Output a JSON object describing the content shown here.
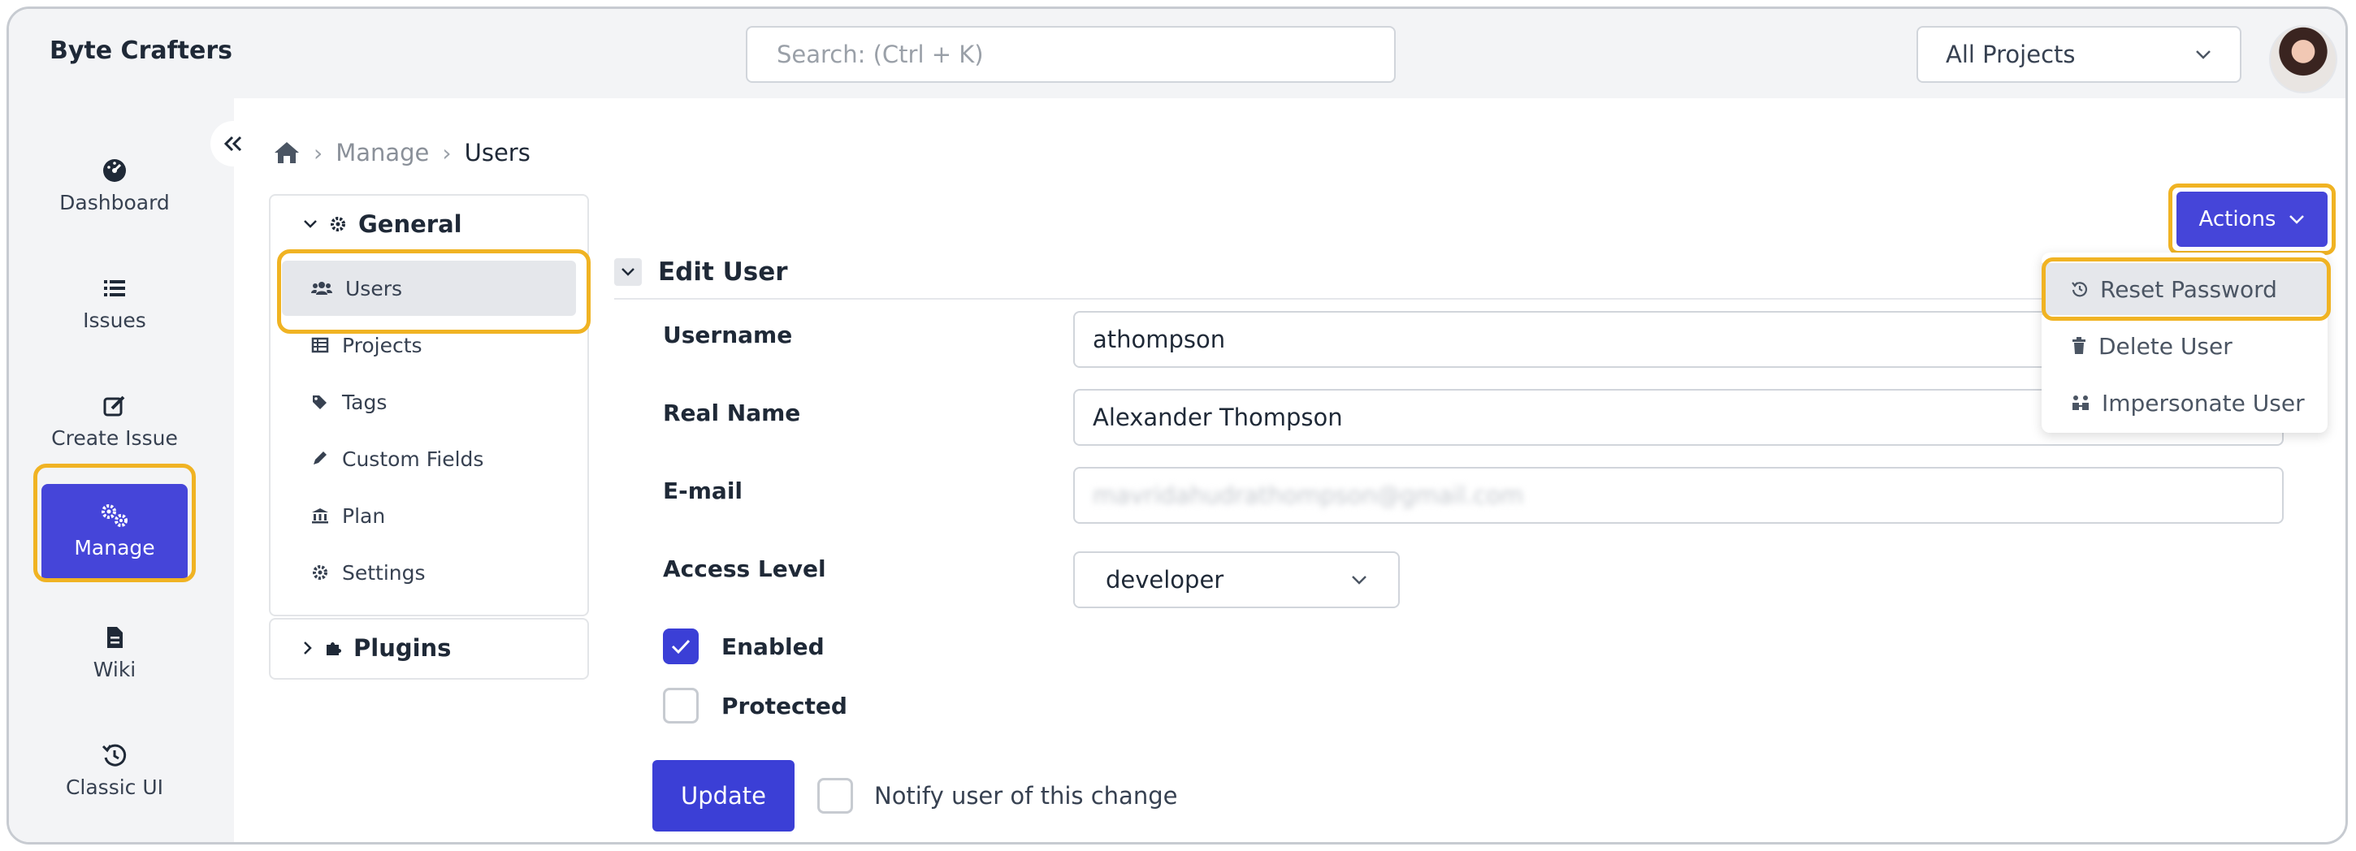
{
  "app": {
    "brand": "Byte Crafters"
  },
  "header": {
    "search_placeholder": "Search: (Ctrl + K)",
    "project_select": "All Projects"
  },
  "leftnav": {
    "items": [
      {
        "label": "Dashboard",
        "icon": "dashboard-icon"
      },
      {
        "label": "Issues",
        "icon": "list-icon"
      },
      {
        "label": "Create Issue",
        "icon": "edit-icon"
      },
      {
        "label": "Manage",
        "icon": "gears-icon",
        "active": true
      },
      {
        "label": "Wiki",
        "icon": "file-icon"
      },
      {
        "label": "Classic UI",
        "icon": "history-icon"
      }
    ]
  },
  "breadcrumb": {
    "items": [
      "Manage",
      "Users"
    ]
  },
  "sections": {
    "general": "General",
    "items": [
      "Users",
      "Projects",
      "Tags",
      "Custom Fields",
      "Plan",
      "Settings"
    ],
    "plugins": "Plugins"
  },
  "edit_user": {
    "title": "Edit User",
    "username_label": "Username",
    "username_value": "athompson",
    "realname_label": "Real Name",
    "realname_value": "Alexander Thompson",
    "email_label": "E-mail",
    "email_value": "mavridahudrathompson@gmail.com",
    "access_label": "Access Level",
    "access_value": "developer",
    "enabled_label": "Enabled",
    "enabled": true,
    "protected_label": "Protected",
    "protected": false,
    "update_label": "Update",
    "notify_label": "Notify user of this change"
  },
  "actions": {
    "label": "Actions",
    "menu": [
      "Reset Password",
      "Delete User",
      "Impersonate User"
    ]
  },
  "colors": {
    "accent": "#4545d9",
    "highlight": "#f0b323"
  }
}
